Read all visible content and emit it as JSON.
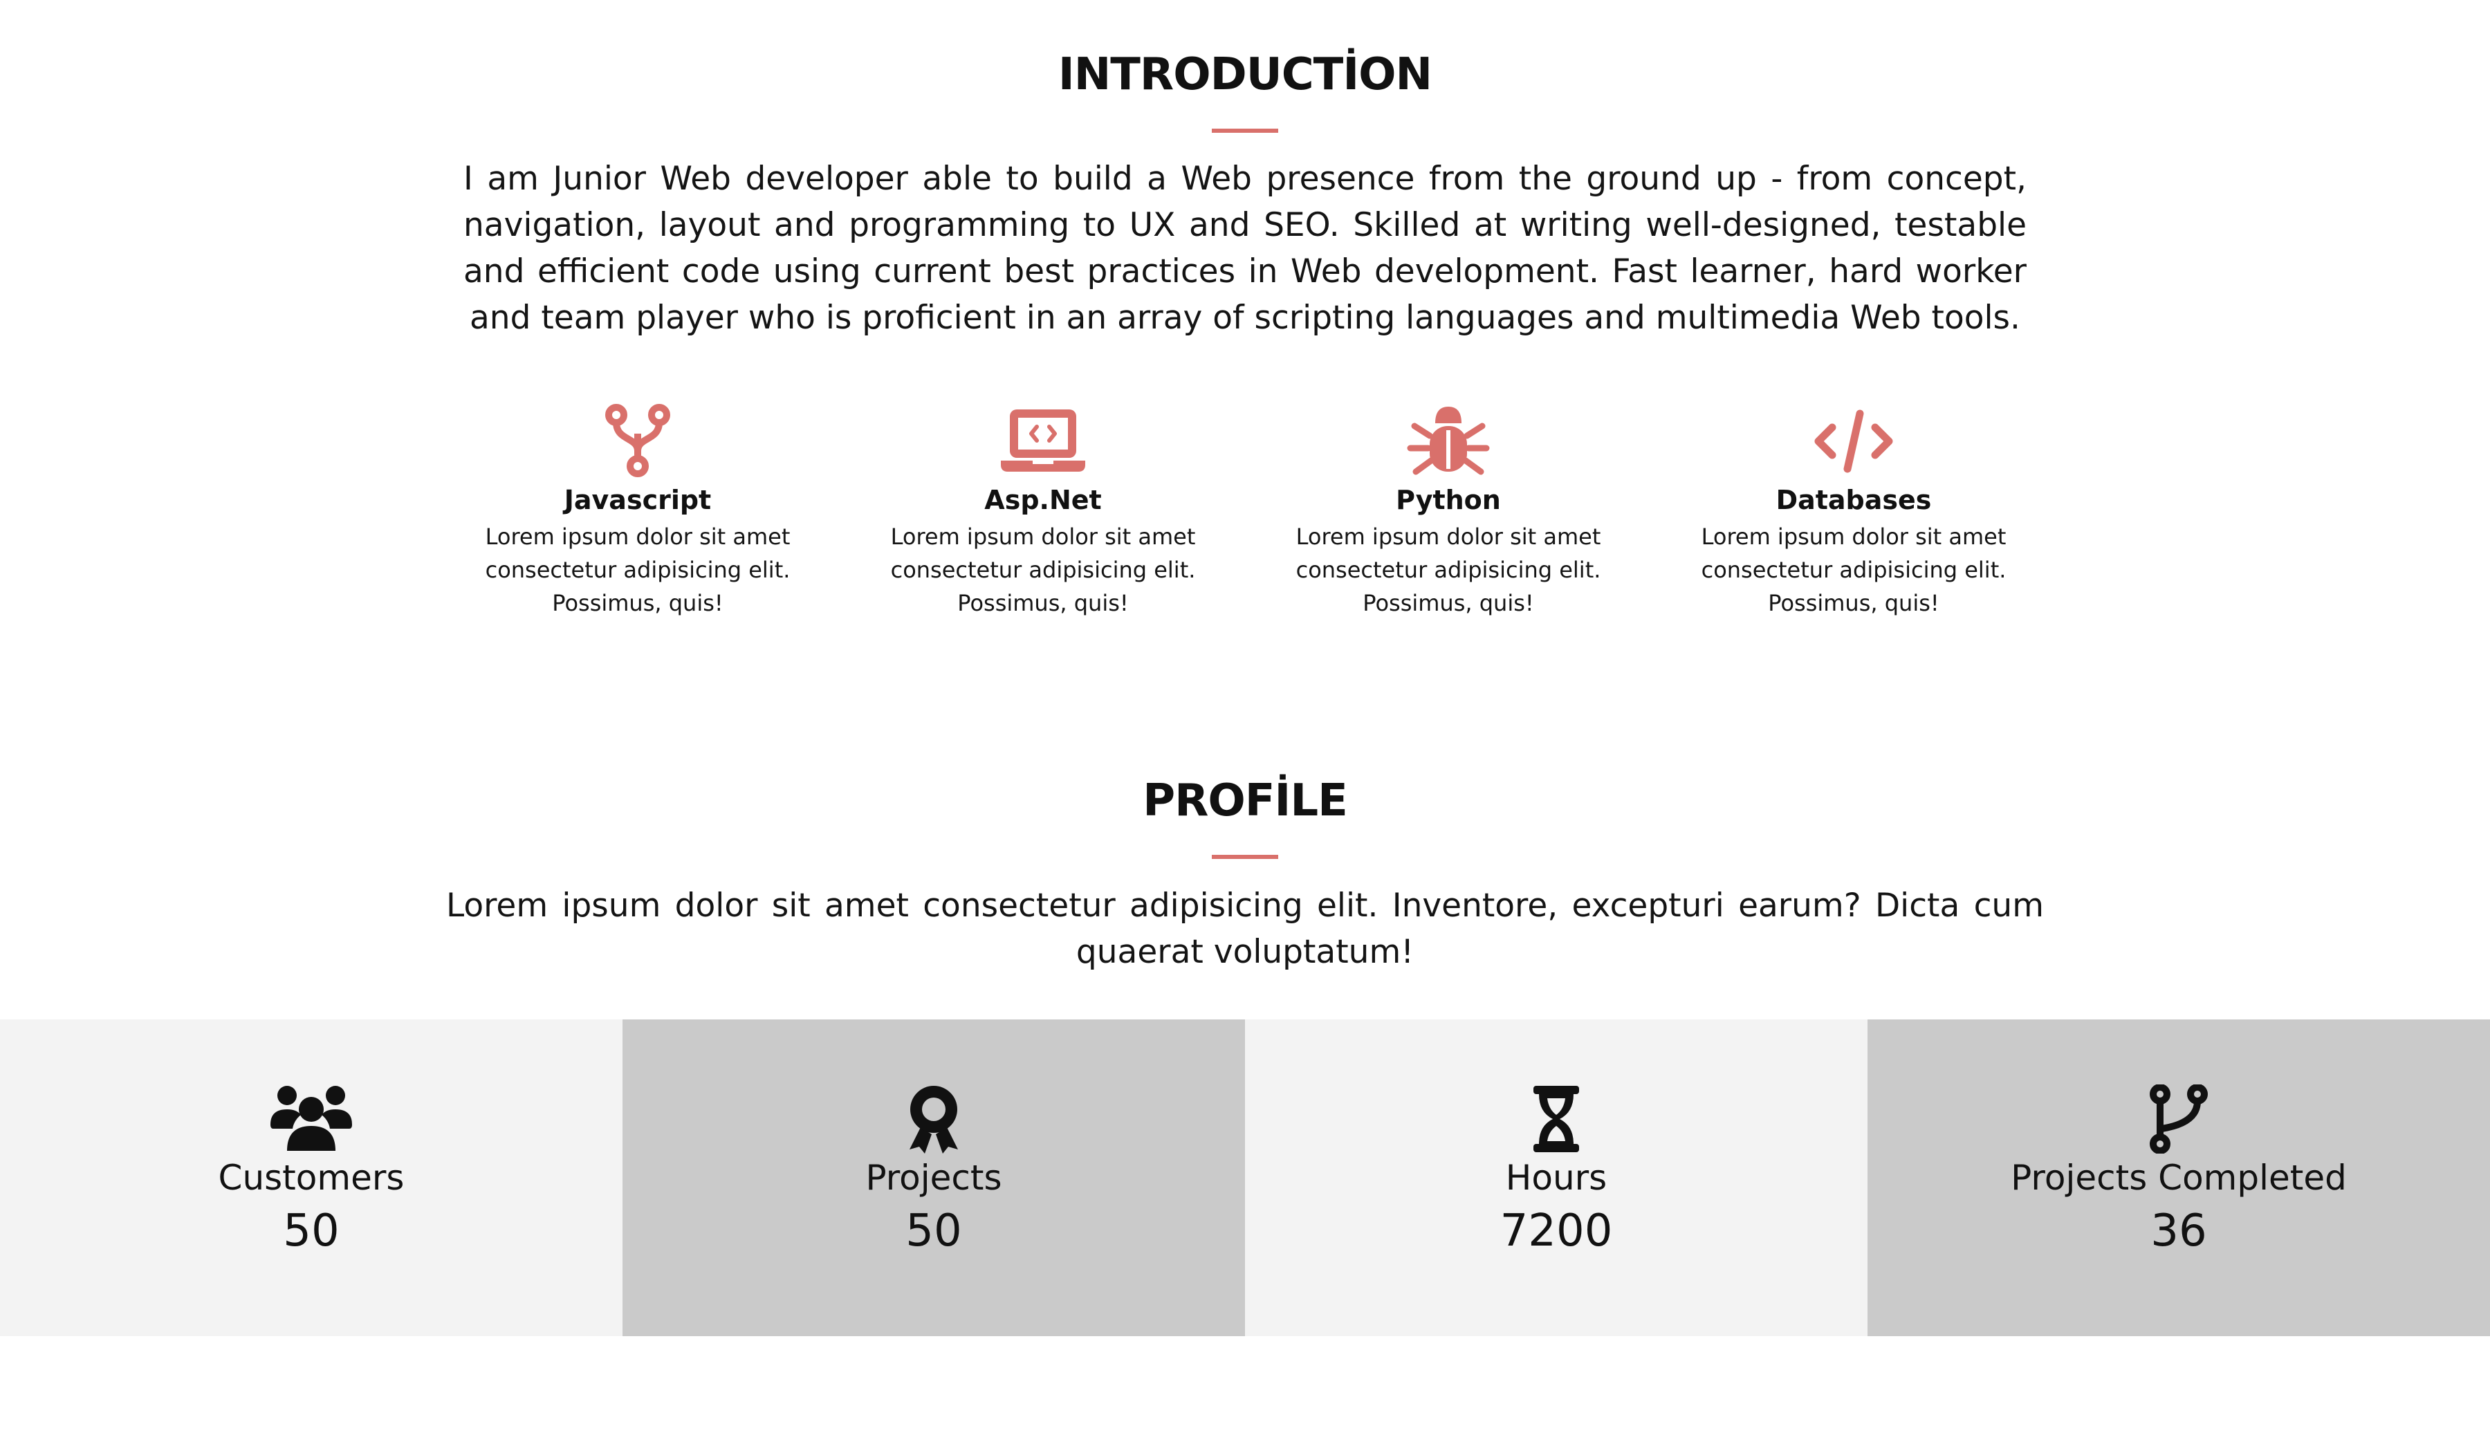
{
  "colors": {
    "accent": "#d9706b",
    "stat_light": "#f3f3f3",
    "stat_dark": "#cacaca",
    "text": "#111111"
  },
  "introduction": {
    "title": "INTRODUCTİON",
    "text": "I am Junior Web developer able to build a Web presence from the ground up - from concept, navigation, layout and programming to UX and SEO. Skilled at writing well-designed, testable and efficient code using current best practices in Web development. Fast learner, hard worker and team player who is proficient in an array of scripting languages and multimedia Web tools."
  },
  "skills": [
    {
      "icon": "code-branch-icon",
      "title": "Javascript",
      "desc_lines": [
        "Lorem ipsum dolor sit amet",
        "consectetur adipisicing elit.",
        "Possimus, quis!"
      ]
    },
    {
      "icon": "laptop-code-icon",
      "title": "Asp.Net",
      "desc_lines": [
        "Lorem ipsum dolor sit amet",
        "consectetur adipisicing elit.",
        "Possimus, quis!"
      ]
    },
    {
      "icon": "bug-icon",
      "title": "Python",
      "desc_lines": [
        "Lorem ipsum dolor sit amet",
        "consectetur adipisicing elit.",
        "Possimus, quis!"
      ]
    },
    {
      "icon": "code-icon",
      "title": "Databases",
      "desc_lines": [
        "Lorem ipsum dolor sit amet",
        "consectetur adipisicing elit.",
        "Possimus, quis!"
      ]
    }
  ],
  "profile": {
    "title": "PROFİLE",
    "text": "Lorem ipsum dolor sit amet consectetur adipisicing elit. Inventore, excepturi earum? Dicta cum quaerat voluptatum!"
  },
  "stats": [
    {
      "icon": "users-icon",
      "label": "Customers",
      "value": "50"
    },
    {
      "icon": "award-icon",
      "label": "Projects",
      "value": "50"
    },
    {
      "icon": "hourglass-icon",
      "label": "Hours",
      "value": "7200"
    },
    {
      "icon": "code-branch-icon",
      "label": "Projects Completed",
      "value": "36"
    }
  ]
}
